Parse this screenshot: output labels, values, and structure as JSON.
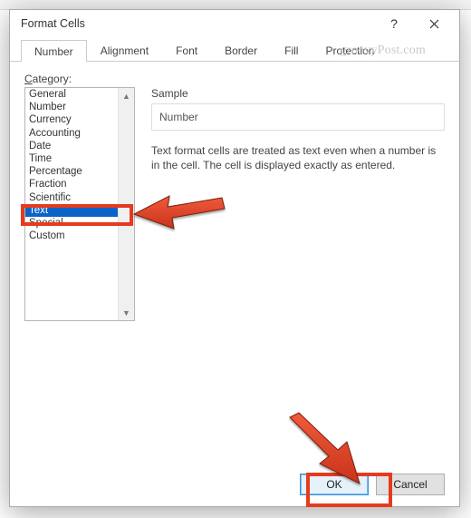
{
  "dialog": {
    "title": "Format Cells",
    "help_label": "?",
    "close_label": "✕"
  },
  "tabs": [
    {
      "label": "Number",
      "active": true
    },
    {
      "label": "Alignment",
      "active": false
    },
    {
      "label": "Font",
      "active": false
    },
    {
      "label": "Border",
      "active": false
    },
    {
      "label": "Fill",
      "active": false
    },
    {
      "label": "Protection",
      "active": false
    }
  ],
  "category": {
    "label_prefix": "C",
    "label_rest": "ategory:",
    "items": [
      "General",
      "Number",
      "Currency",
      "Accounting",
      "Date",
      "Time",
      "Percentage",
      "Fraction",
      "Scientific",
      "Text",
      "Special",
      "Custom"
    ],
    "selected_index": 9
  },
  "sample": {
    "label": "Sample",
    "value": "Number"
  },
  "description": "Text format cells are treated as text even when a number is in the cell. The cell is displayed exactly as entered.",
  "buttons": {
    "ok": "OK",
    "cancel": "Cancel"
  },
  "watermark": "groovyPost.com"
}
